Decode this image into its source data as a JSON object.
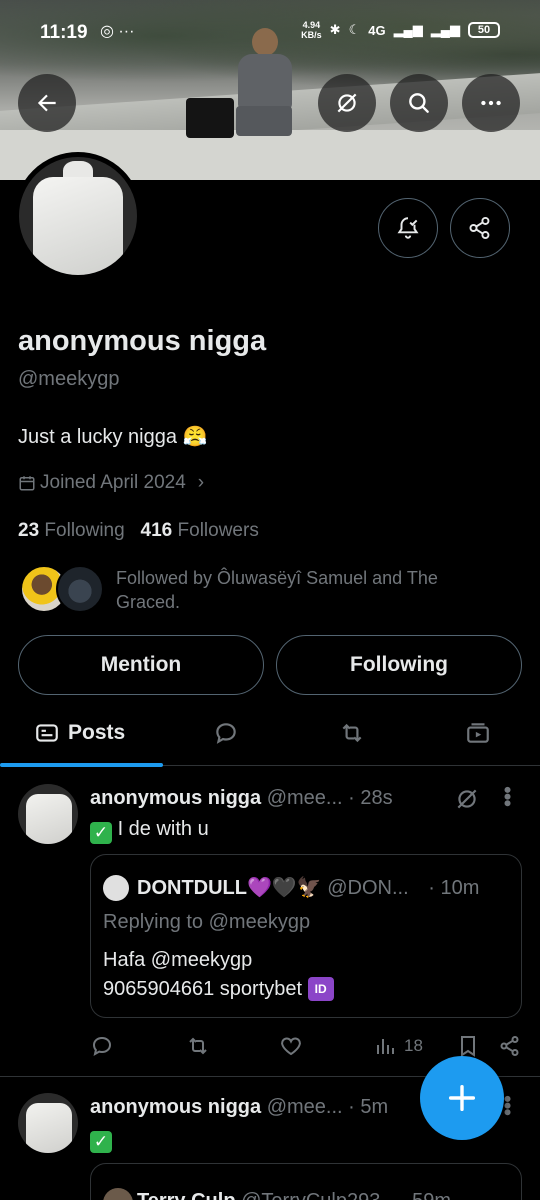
{
  "status_bar": {
    "time": "11:19",
    "left_icons": "◎ ···",
    "net_speed_value": "4.94",
    "net_speed_unit": "KB/s",
    "network": "4G",
    "battery": "50"
  },
  "profile": {
    "display_name": "anonymous nigga",
    "handle": "@meekygp",
    "bio": "Just a lucky nigga 😤",
    "joined": "Joined April 2024",
    "following_count": "23",
    "following_label": "Following",
    "followers_count": "416",
    "followers_label": "Followers",
    "followed_by": "Followed by Ôluwasëyî Samuel and The Graced."
  },
  "buttons": {
    "mention": "Mention",
    "following": "Following"
  },
  "tabs": [
    {
      "label": "Posts",
      "active": true
    },
    {
      "label": "",
      "icon": "reply-icon"
    },
    {
      "label": "",
      "icon": "repost-icon"
    },
    {
      "label": "",
      "icon": "media-icon"
    }
  ],
  "posts": [
    {
      "name": "anonymous nigga",
      "handle": "@mee...",
      "time": "· 28s",
      "text": "I de with u",
      "quote": {
        "name": "DONTDULL💜🖤🦅",
        "handle": "@DON...",
        "time": "· 10m",
        "replying": "Replying to @meekygp",
        "line1": "Hafa @meekygp",
        "line2": "9065904661 sportybet",
        "badge": "ID"
      },
      "views": "18"
    },
    {
      "name": "anonymous nigga",
      "handle": "@mee...",
      "time": "· 5m",
      "quote": {
        "name": "Terry Culp",
        "handle": "@TerryCulp293",
        "time": "· 59m"
      }
    }
  ],
  "colors": {
    "accent": "#1d9bf0",
    "background": "#000000",
    "muted": "#71767b",
    "text": "#e7e9ea",
    "border": "#2f3336"
  }
}
